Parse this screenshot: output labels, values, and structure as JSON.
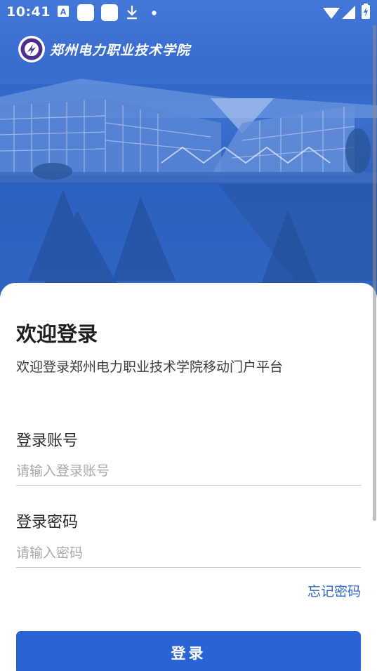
{
  "status_bar": {
    "time": "10:41",
    "icons": [
      "keyboard-a-icon",
      "app-square-icon",
      "app-square-icon",
      "download-icon",
      "dot-icon",
      "wifi-icon",
      "signal-icon",
      "battery-icon"
    ]
  },
  "header": {
    "logo_icon": "college-seal-icon",
    "college_name": "郑州电力职业技术学院",
    "banner_image": "campus-building-photo"
  },
  "login": {
    "title": "欢迎登录",
    "subtitle": "欢迎登录郑州电力职业技术学院移动门户平台",
    "account": {
      "label": "登录账号",
      "placeholder": "请输入登录账号",
      "value": ""
    },
    "password": {
      "label": "登录密码",
      "placeholder": "请输入密码",
      "value": ""
    },
    "forgot_password": "忘记密码",
    "submit_label": "登录"
  },
  "colors": {
    "accent": "#2a63d3",
    "link": "#2f66c9",
    "banner_blue": "#3468c4"
  }
}
